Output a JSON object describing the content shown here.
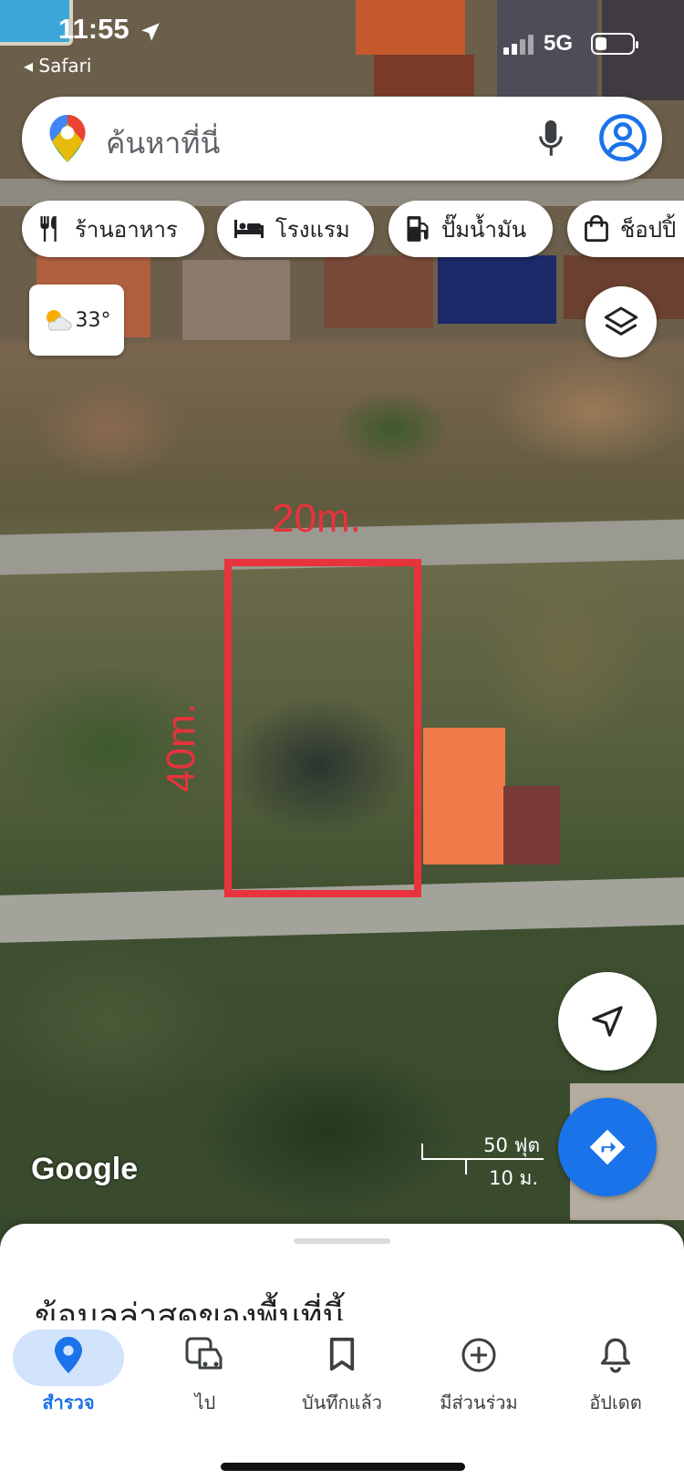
{
  "status_bar": {
    "time": "11:55",
    "back_app": "◂ Safari",
    "network": "5G",
    "battery_level": 0.3
  },
  "search": {
    "placeholder": "ค้นหาที่นี่",
    "icons": [
      "maps-pin-icon",
      "microphone-icon",
      "account-icon"
    ]
  },
  "chips": [
    {
      "label": "ร้านอาหาร",
      "icon": "restaurant-icon"
    },
    {
      "label": "โรงแรม",
      "icon": "hotel-icon"
    },
    {
      "label": "ปั๊มน้ำมัน",
      "icon": "gas-station-icon"
    },
    {
      "label": "ช็อปปิ้",
      "icon": "shopping-bag-icon"
    }
  ],
  "weather": {
    "temperature": "33°",
    "icon": "partly-cloudy-icon"
  },
  "map": {
    "annotation_width": "20m.",
    "annotation_length": "40m.",
    "attribution": "Google",
    "scale_feet": "50 ฟุต",
    "scale_meters": "10 ม.",
    "annotation_color": "#e8323c"
  },
  "bottom_sheet": {
    "title": "ข้อมูลล่าสุดของพื้นที่นี้"
  },
  "nav": {
    "items": [
      {
        "label": "สำรวจ",
        "icon": "explore-pin-icon",
        "active": true
      },
      {
        "label": "ไป",
        "icon": "commute-car-icon",
        "active": false
      },
      {
        "label": "บันทึกแล้ว",
        "icon": "bookmark-icon",
        "active": false
      },
      {
        "label": "มีส่วนร่วม",
        "icon": "add-circle-icon",
        "active": false
      },
      {
        "label": "อัปเดต",
        "icon": "bell-icon",
        "active": false
      }
    ]
  },
  "colors": {
    "accent": "#1a73e8",
    "active_pill": "#d2e3fc"
  }
}
